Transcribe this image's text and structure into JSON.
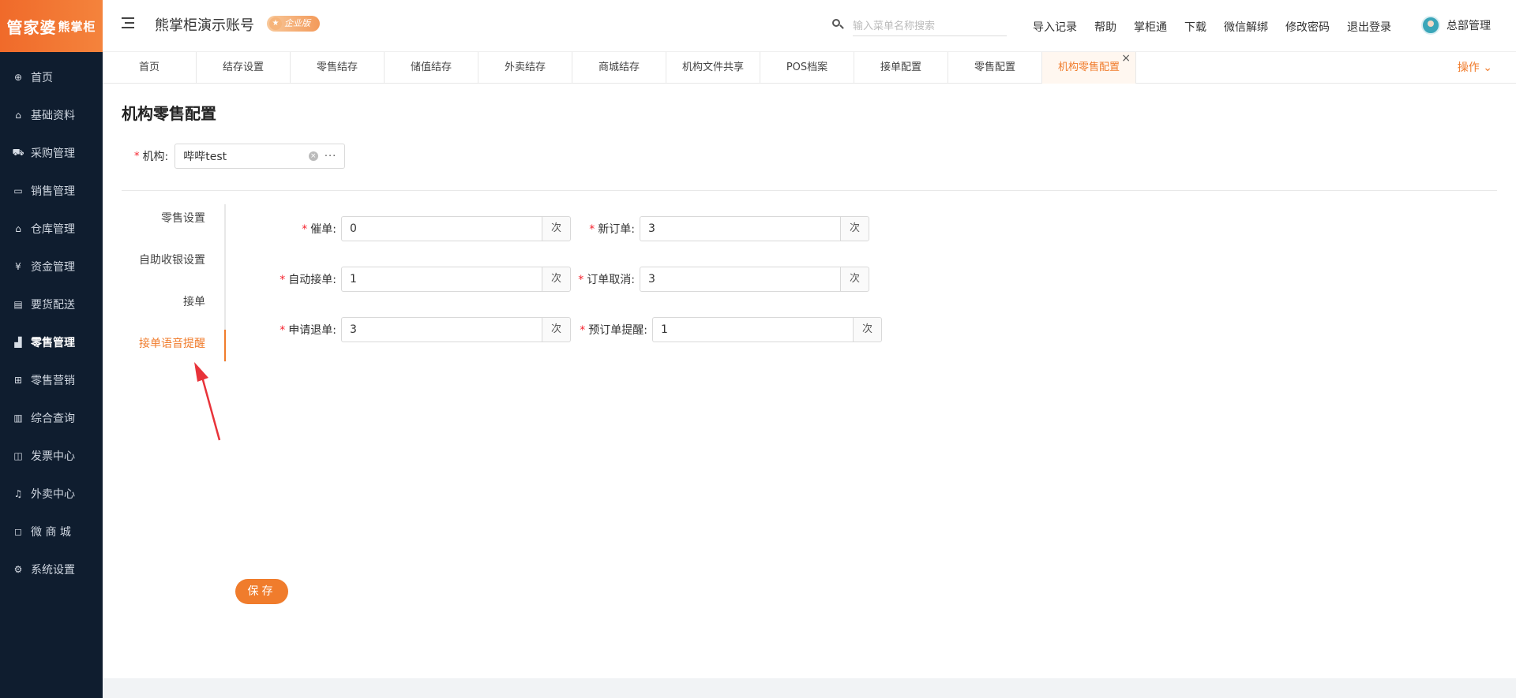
{
  "logo": {
    "main": "管家婆",
    "sub": "熊掌柜"
  },
  "sidebar": {
    "items": [
      {
        "label": "首页",
        "icon": "globe-icon",
        "glyph": "⊕"
      },
      {
        "label": "基础资料",
        "icon": "home-icon",
        "glyph": "⌂"
      },
      {
        "label": "采购管理",
        "icon": "cart-icon",
        "glyph": "⛟"
      },
      {
        "label": "销售管理",
        "icon": "sales-icon",
        "glyph": "▭"
      },
      {
        "label": "仓库管理",
        "icon": "warehouse-icon",
        "glyph": "⌂"
      },
      {
        "label": "资金管理",
        "icon": "money-icon",
        "glyph": "¥"
      },
      {
        "label": "要货配送",
        "icon": "delivery-icon",
        "glyph": "▤"
      },
      {
        "label": "零售管理",
        "icon": "chart-icon",
        "glyph": "▟",
        "active": true
      },
      {
        "label": "零售营销",
        "icon": "gift-icon",
        "glyph": "⊞"
      },
      {
        "label": "综合查询",
        "icon": "bar-chart-icon",
        "glyph": "▥"
      },
      {
        "label": "发票中心",
        "icon": "invoice-icon",
        "glyph": "◫"
      },
      {
        "label": "外卖中心",
        "icon": "takeout-icon",
        "glyph": "♫"
      },
      {
        "label": "微 商 城",
        "icon": "bag-icon",
        "glyph": "◻"
      },
      {
        "label": "系统设置",
        "icon": "gear-icon",
        "glyph": "⚙"
      }
    ]
  },
  "header": {
    "account_title": "熊掌柜演示账号",
    "badge": "企业版",
    "search_placeholder": "输入菜单名称搜索",
    "links": [
      "导入记录",
      "帮助",
      "掌柜通",
      "下载",
      "微信解绑",
      "修改密码",
      "退出登录"
    ],
    "user_name": "总部管理"
  },
  "tabs": {
    "items": [
      "首页",
      "结存设置",
      "零售结存",
      "储值结存",
      "外卖结存",
      "商城结存",
      "机构文件共享",
      "POS档案",
      "接单配置",
      "零售配置",
      "机构零售配置"
    ],
    "active_index": 10,
    "close_symbol": "×",
    "ops_label": "操作 ⌄"
  },
  "page": {
    "title": "机构零售配置",
    "org_label": "机构:",
    "org_value": "哔哔test",
    "clear_symbol": "×",
    "more_symbol": "···"
  },
  "side_tabs": {
    "items": [
      "零售设置",
      "自助收银设置",
      "接单",
      "接单语音提醒"
    ],
    "active_index": 3
  },
  "form": {
    "unit": "次",
    "fields": [
      {
        "label": "催单:",
        "value": "0"
      },
      {
        "label": "新订单:",
        "value": "3"
      },
      {
        "label": "自动接单:",
        "value": "1"
      },
      {
        "label": "订单取消:",
        "value": "3"
      },
      {
        "label": "申请退单:",
        "value": "3"
      },
      {
        "label": "预订单提醒:",
        "value": "1"
      }
    ]
  },
  "actions": {
    "save_label": "保存"
  },
  "colors": {
    "accent": "#f07c2c",
    "sidebar_bg": "#0f1d2f",
    "required": "#f5222d",
    "annotation_arrow": "#e8333a"
  }
}
